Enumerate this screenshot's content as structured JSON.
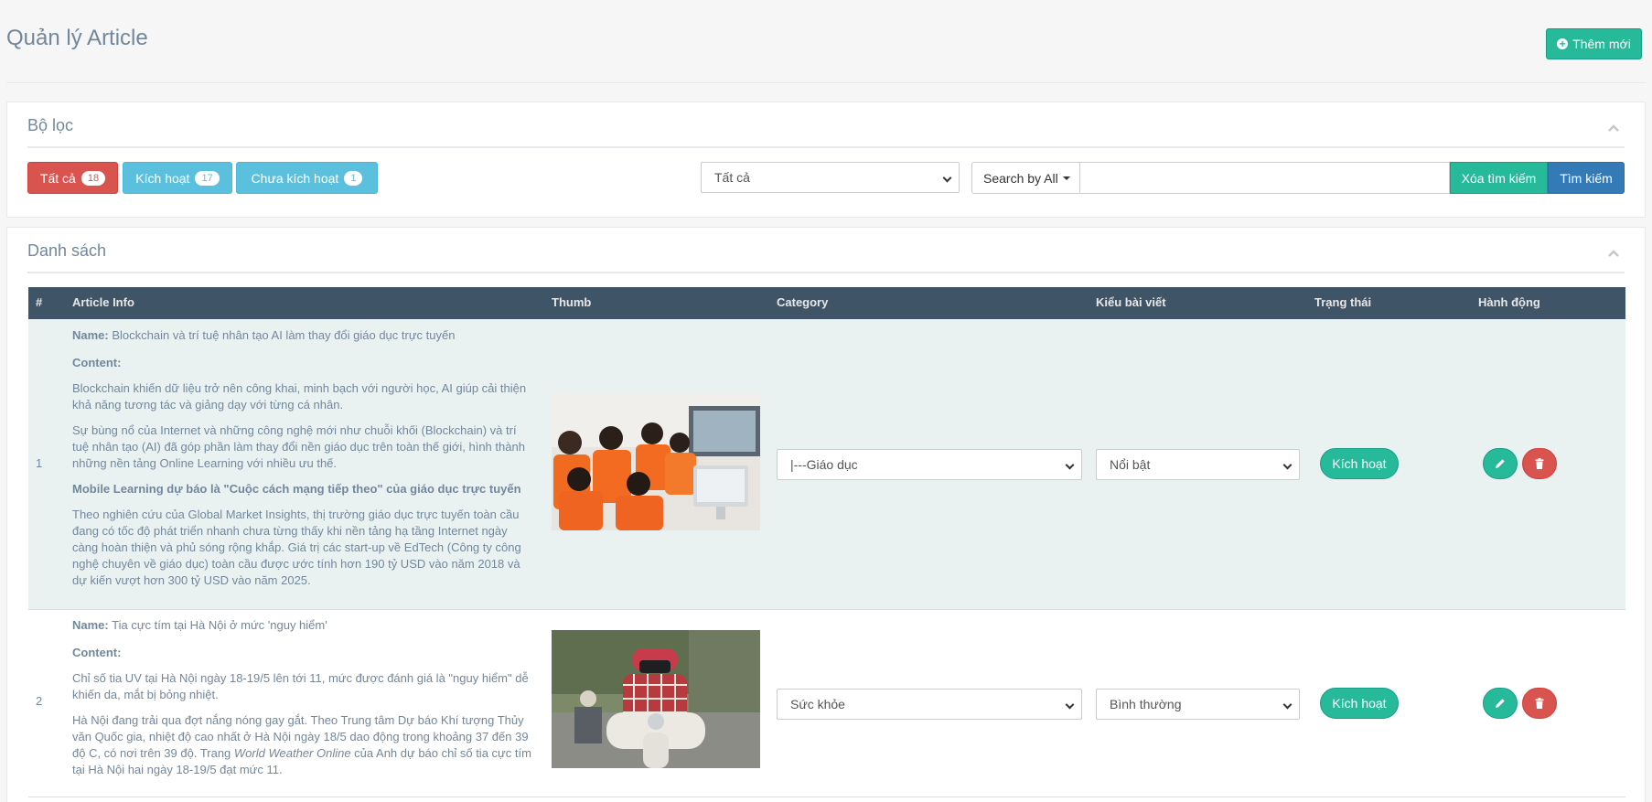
{
  "page": {
    "title": "Quản lý Article",
    "add_button": "Thêm mới"
  },
  "filter": {
    "heading": "Bộ lọc",
    "tags": [
      {
        "label": "Tất cả",
        "count": "18"
      },
      {
        "label": "Kích hoạt",
        "count": "17"
      },
      {
        "label": "Chưa kích hoạt",
        "count": "1"
      }
    ],
    "category_select": "Tất cả",
    "search_by": "Search by All",
    "search_value": "",
    "clear_button": "Xóa tìm kiếm",
    "search_button": "Tìm kiếm"
  },
  "list": {
    "heading": "Danh sách",
    "columns": [
      "#",
      "Article Info",
      "Thumb",
      "Category",
      "Kiểu bài viết",
      "Trạng thái",
      "Hành động"
    ],
    "rows": [
      {
        "num": "1",
        "name_label": "Name:",
        "name": "Blockchain và trí tuệ nhân tạo AI làm thay đổi giáo dục trực tuyến",
        "content_label": "Content:",
        "para1": "Blockchain khiến dữ liệu trở nên công khai, minh bạch với người học, AI giúp cải thiện khả năng tương tác và giảng dạy với từng cá nhân.",
        "para2": "Sự bùng nổ của Internet và những công nghệ mới như chuỗi khối (Blockchain) và trí tuệ nhân tạo (AI) đã góp phần làm thay đổi nền giáo dục trên toàn thế giới, hình thành những nền tảng Online Learning với nhiều ưu thế.",
        "subheading": "Mobile Learning dự báo là \"Cuộc cách mạng tiếp theo\" của giáo dục trực tuyến",
        "para3": "Theo nghiên cứu của Global Market Insights, thị trường giáo dục trực tuyến toàn cầu đang có tốc độ phát triển nhanh chưa từng thấy khi nền tảng hạ tầng Internet ngày càng hoàn thiện và phủ sóng rộng khắp. Giá trị các start-up về EdTech (Công ty công nghệ chuyên về giáo dục) toàn cầu được ước tính hơn 190 tỷ USD vào năm 2018 và dự kiến vượt hơn 300 tỷ USD vào năm 2025.",
        "category": "|---Giáo dục",
        "type": "Nổi bật",
        "status": "Kích hoạt"
      },
      {
        "num": "2",
        "name_label": "Name:",
        "name": "Tia cực tím tại Hà Nội ở mức 'nguy hiểm'",
        "content_label": "Content:",
        "para1": "Chỉ số tia UV tại Hà Nội ngày 18-19/5 lên tới 11, mức được đánh giá là \"nguy hiểm\" dễ khiến da, mắt bị bỏng nhiệt.",
        "para2_a": "Hà Nội đang trải qua đợt nắng nóng gay gắt. Theo Trung tâm Dự báo Khí tượng Thủy văn Quốc gia, nhiệt độ cao nhất ở Hà Nội ngày 18/5 dao động trong khoảng 37 đến 39 độ C, có nơi trên 39 độ. Trang ",
        "para2_em": "World Weather Online",
        "para2_b": " của Anh dự báo chỉ số tia cực tím tại Hà Nội hai ngày 18-19/5 đạt mức 11.",
        "category": "Sức khỏe",
        "type": "Bình thường",
        "status": "Kích hoạt"
      }
    ]
  }
}
